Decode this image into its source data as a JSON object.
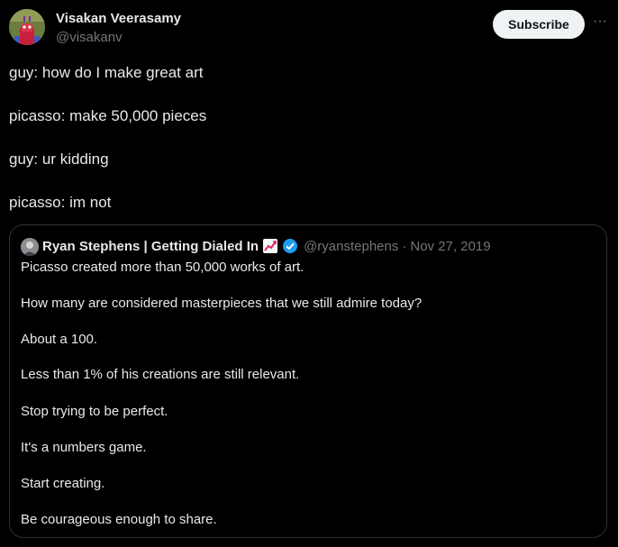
{
  "author": {
    "display_name": "Visakan Veerasamy",
    "handle": "@visakanv"
  },
  "actions": {
    "subscribe_label": "Subscribe",
    "more_label": "···"
  },
  "tweet_lines": [
    "guy: how do I make great art",
    "picasso: make 50,000 pieces",
    "guy: ur kidding",
    "picasso: im not"
  ],
  "quoted": {
    "display_name": "Ryan Stephens | Getting Dialed In",
    "handle": "@ryanstephens",
    "separator": "·",
    "date": "Nov 27, 2019",
    "lines": [
      "Picasso created more than 50,000 works of art.",
      "How many are considered masterpieces that we still admire today?",
      "About a 100.",
      "Less than 1% of his creations are still relevant.",
      "Stop trying to be perfect.",
      "It's a numbers game.",
      "Start creating.",
      "Be courageous enough to share."
    ]
  },
  "colors": {
    "background": "#000000",
    "text_primary": "#e7e9ea",
    "text_secondary": "#71767b",
    "border": "#2f3336",
    "verified": "#1d9bf0",
    "button_bg": "#eff3f4"
  },
  "icons": {
    "avatar": "cartoon-avatar-icon",
    "chart_emoji": "chart-increasing-icon",
    "verified": "verified-badge-icon",
    "more": "more-dots-icon"
  }
}
